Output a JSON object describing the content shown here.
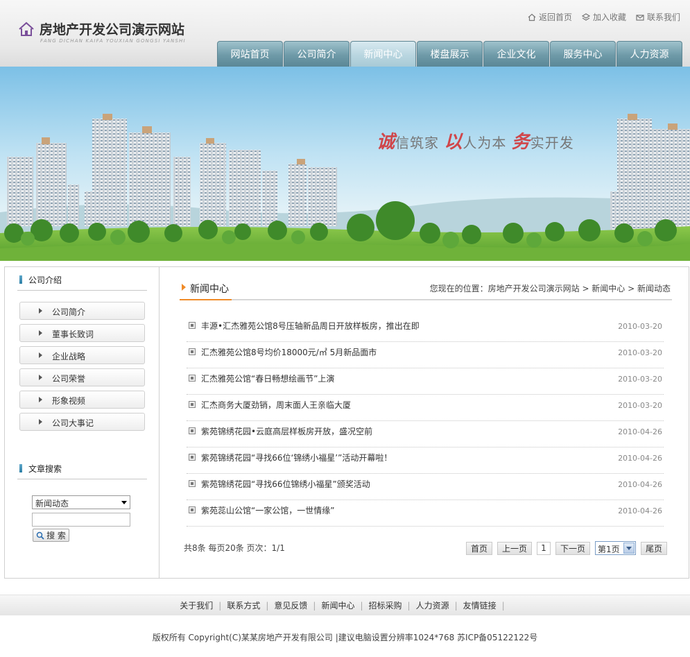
{
  "site": {
    "title": "房地产开发公司演示网站",
    "subtitle": "FANG DICHAN KAIFA YOUXIAN GONGSI YANSHI"
  },
  "toplinks": [
    {
      "label": "返回首页",
      "icon": "home-icon"
    },
    {
      "label": "加入收藏",
      "icon": "bookmark-icon"
    },
    {
      "label": "联系我们",
      "icon": "contact-icon"
    }
  ],
  "nav": [
    "网站首页",
    "公司简介",
    "新闻中心",
    "楼盘展示",
    "企业文化",
    "服务中心",
    "人力资源"
  ],
  "nav_active": "新闻中心",
  "banner": {
    "slogan": {
      "c1": "诚",
      "t1": "信筑家 ",
      "c2": "以",
      "t2": "人为本 ",
      "c3": "务",
      "t3": "实开发"
    }
  },
  "sidebar": {
    "about_title": "公司介绍",
    "menu": [
      "公司简介",
      "董事长致词",
      "企业战略",
      "公司荣誉",
      "形象视频",
      "公司大事记"
    ],
    "search_title": "文章搜索",
    "search_select": "新闻动态",
    "search_button": "搜 索"
  },
  "content": {
    "title": "新闻中心",
    "breadcrumb": "您现在的位置：房地产开发公司演示网站  > 新闻中心  > 新闻动态",
    "news": [
      {
        "title": "丰源•汇杰雅苑公馆8号压轴新品周日开放样板房，推出在即",
        "date": "2010-03-20"
      },
      {
        "title": "汇杰雅苑公馆8号均价18000元/㎡ 5月新品面市",
        "date": "2010-03-20"
      },
      {
        "title": "汇杰雅苑公馆“春日畅想绘画节”上演",
        "date": "2010-03-20"
      },
      {
        "title": "汇杰商务大厦劲销，周末面人王亲临大厦",
        "date": "2010-03-20"
      },
      {
        "title": "紫苑锦绣花园•云庭高层样板房开放，盛况空前",
        "date": "2010-04-26"
      },
      {
        "title": "紫苑锦绣花园“寻找66位‘锦绣小福星’”活动开幕啦！",
        "date": "2010-04-26"
      },
      {
        "title": "紫苑锦绣花园“寻找66位锦绣小福星”颁奖活动",
        "date": "2010-04-26"
      },
      {
        "title": "紫苑蕊山公馆“一家公馆，一世情缘”",
        "date": "2010-04-26"
      }
    ],
    "pager": {
      "info": "共8条  每页20条  页次：1/1",
      "first": "首页",
      "prev": "上一页",
      "current": "1",
      "next": "下一页",
      "select": "第1页",
      "last": "尾页"
    }
  },
  "footer": {
    "links": [
      "关于我们",
      "联系方式",
      "意见反馈",
      "新闻中心",
      "招标采购",
      "人力资源",
      "友情链接"
    ],
    "copyright": "版权所有  Copyright(C)某某房地产开发有限公司  |建议电脑设置分辨率1024*768 苏ICP备05122122号"
  }
}
